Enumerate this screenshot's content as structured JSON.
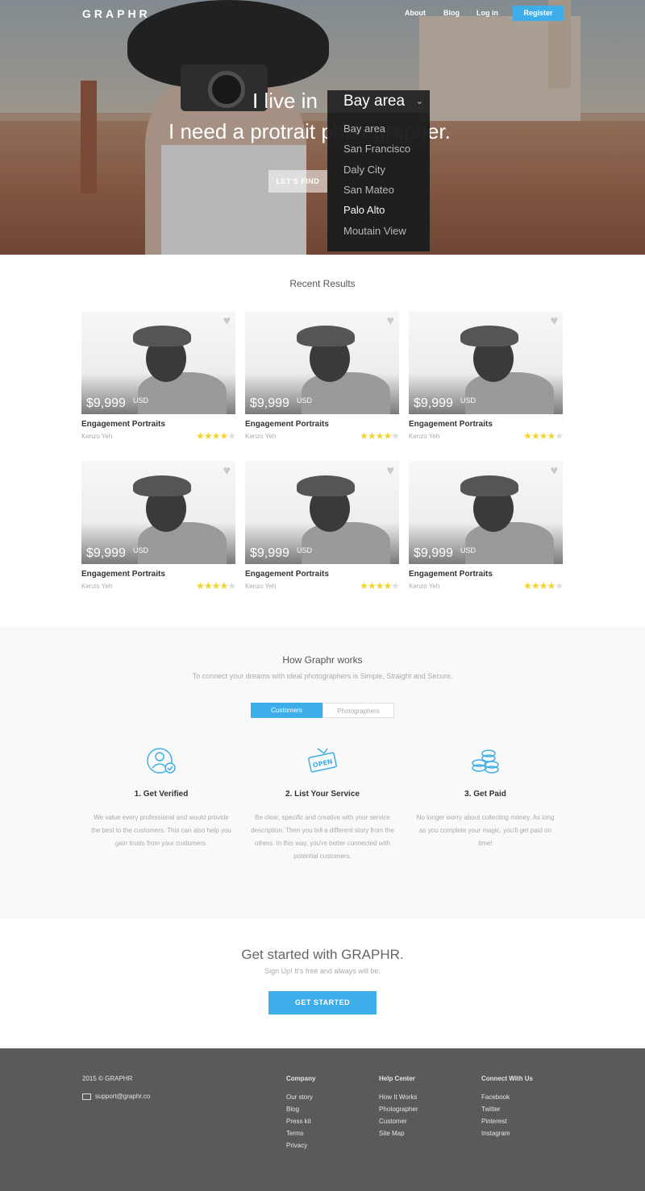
{
  "nav": {
    "logo": "GRAPHR",
    "about": "About",
    "blog": "Blog",
    "login": "Log in",
    "register": "Register"
  },
  "hero": {
    "line1": "I live in",
    "line2": "I need a protrait photographer.",
    "selected": "Bay area",
    "options": [
      "Bay area",
      "San Francisco",
      "Daly City",
      "San Mateo",
      "Palo Alto",
      "Moutain View"
    ],
    "highlighted": "Palo Alto",
    "cta": "LET'S FIND"
  },
  "recent": {
    "title": "Recent Results",
    "cards": [
      {
        "price": "$9,999",
        "currency": "USD",
        "title": "Engagement Portraits",
        "author": "Kenzo Yeh",
        "rating": 4
      },
      {
        "price": "$9,999",
        "currency": "USD",
        "title": "Engagement Portraits",
        "author": "Kenzo Yeh",
        "rating": 4
      },
      {
        "price": "$9,999",
        "currency": "USD",
        "title": "Engagement Portraits",
        "author": "Kenzo Yeh",
        "rating": 4
      },
      {
        "price": "$9,999",
        "currency": "USD",
        "title": "Engagement Portraits",
        "author": "Kenzo Yeh",
        "rating": 4
      },
      {
        "price": "$9,999",
        "currency": "USD",
        "title": "Engagement Portraits",
        "author": "Kenzo Yeh",
        "rating": 4
      },
      {
        "price": "$9,999",
        "currency": "USD",
        "title": "Engagement Portraits",
        "author": "Kenzo Yeh",
        "rating": 4
      }
    ]
  },
  "how": {
    "title": "How Graphr works",
    "subtitle": "To connect your dreams with ideal photographers is  Simple, Straight and Secure.",
    "tabs": [
      "Customers",
      "Photographers"
    ],
    "steps": [
      {
        "icon": "user-verified-icon",
        "title": "1. Get Verified",
        "desc": "We value every professional and would provide the best to the customers. This can also help you gain trusts from your customers."
      },
      {
        "icon": "open-sign-icon",
        "title": "2. List Your Service",
        "desc": "Be clear, specific and creative with your service description. Then you tell a different story from the others. In this way, you're better connected with potential customers."
      },
      {
        "icon": "coins-icon",
        "title": "3. Get Paid",
        "desc": "No longer worry about collecting money. As long as you complete your magic, you'll get paid on time!"
      }
    ]
  },
  "get_started": {
    "title": "Get started with GRAPHR.",
    "subtitle": "Sign Up! It's free and always will be.",
    "button": "GET STARTED"
  },
  "footer": {
    "copyright": "2015 © GRAPHR",
    "email": "support@graphr.co",
    "columns": [
      {
        "title": "Company",
        "links": [
          "Our story",
          "Blog",
          "Press kit",
          "Terms",
          "Privacy"
        ]
      },
      {
        "title": "Help Center",
        "links": [
          "How It Works",
          "Photographer",
          "Customer",
          "Site Map"
        ]
      },
      {
        "title": "Connect With Us",
        "links": [
          "Facebook",
          "Twitter",
          "Pinterest",
          "Instagram"
        ]
      }
    ]
  },
  "colors": {
    "accent": "#3daee9",
    "footer": "#5a5a5a",
    "star": "#f3d22c"
  }
}
